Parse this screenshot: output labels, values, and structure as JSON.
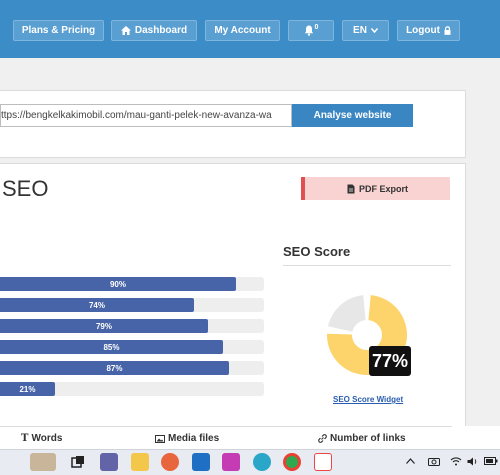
{
  "nav": {
    "plans_label": "Plans & Pricing",
    "dashboard_label": "Dashboard",
    "account_label": "My Account",
    "notification_count": "0",
    "language_label": "EN",
    "logout_label": "Logout"
  },
  "analyser": {
    "url_value": "ttps://bengkelkakimobil.com/mau-ganti-pelek-new-avanza-wa",
    "analyse_label": "Analyse website"
  },
  "report": {
    "title_fragment": "SEO",
    "pdf_label": "PDF Export"
  },
  "bars": [
    {
      "label": "90%",
      "value": 90
    },
    {
      "label": "74%",
      "value": 74
    },
    {
      "label": "79%",
      "value": 79
    },
    {
      "label": "85%",
      "value": 85
    },
    {
      "label": "87%",
      "value": 87
    },
    {
      "label": "21%",
      "value": 21
    }
  ],
  "score": {
    "title": "SEO Score",
    "percent_label": "77%",
    "value": 77,
    "widget_link": "SEO Score Widget",
    "colors": {
      "fill": "#fdd36b",
      "rest": "#e7e7e7"
    }
  },
  "stats": {
    "words_label": "Words",
    "media_label": "Media files",
    "links_label": "Number of links"
  },
  "taskbar": {
    "icons": [
      "cat-widget-icon",
      "task-view-icon",
      "teams-icon",
      "file-explorer-icon",
      "firefox-icon",
      "store-icon",
      "wps-icon",
      "edge-icon",
      "chrome-icon",
      "snipping-tool-icon"
    ],
    "tray": [
      "chevron-up-icon",
      "camera-icon",
      "wifi-icon",
      "speaker-icon",
      "battery-icon"
    ]
  },
  "colors": {
    "brand": "#3b8cc7",
    "bar": "#4864a8",
    "pdf": "#f9d2d2"
  }
}
